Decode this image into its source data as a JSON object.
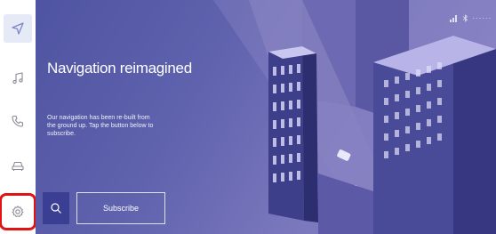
{
  "sidebar": {
    "items": [
      {
        "icon": "navigation-arrow-icon"
      },
      {
        "icon": "music-note-icon"
      },
      {
        "icon": "phone-icon"
      },
      {
        "icon": "car-icon"
      },
      {
        "icon": "gear-icon"
      }
    ]
  },
  "hero": {
    "title": "Navigation reimagined",
    "description": "Our navigation has been re-built from the ground up. Tap the button below to subscribe.",
    "subscribe_label": "Subscribe",
    "search_icon": "search-icon"
  },
  "status": {
    "text": "- - -  - - -"
  },
  "colors": {
    "accent": "#3b3f93",
    "hero_background": "#5f62ad",
    "selection_outline": "#e01414"
  }
}
